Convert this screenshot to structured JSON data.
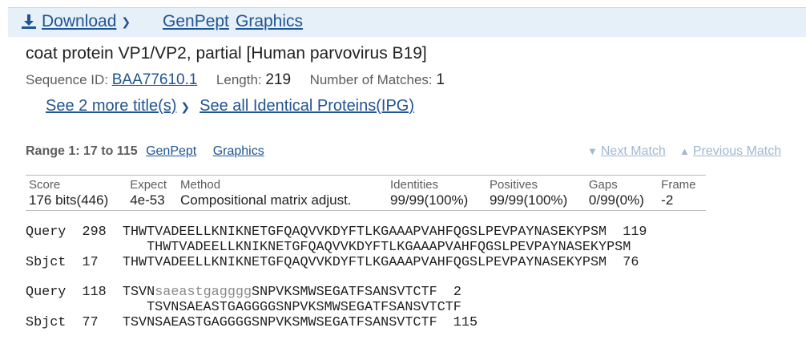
{
  "toolbar": {
    "download_label": "Download",
    "genpept_label": "GenPept",
    "graphics_label": "Graphics"
  },
  "record": {
    "title": "coat protein VP1/VP2, partial [Human parvovirus B19]",
    "seqid_label": "Sequence ID:",
    "seqid_value": "BAA77610.1",
    "length_label": "Length:",
    "length_value": "219",
    "matches_label": "Number of Matches:",
    "matches_value": "1",
    "more_titles_label": "See 2 more title(s)",
    "identical_label": "See all Identical Proteins(IPG)"
  },
  "range": {
    "label": "Range 1: 17 to 115",
    "genpept_label": "GenPept",
    "graphics_label": "Graphics",
    "next_match": "Next Match",
    "previous_match": "Previous Match"
  },
  "stats": {
    "headers": [
      "Score",
      "Expect",
      "Method",
      "Identities",
      "Positives",
      "Gaps",
      "Frame"
    ],
    "values": [
      "176 bits(446)",
      "4e-53",
      "Compositional matrix adjust.",
      "99/99(100%)",
      "99/99(100%)",
      "0/99(0%)",
      "-2"
    ]
  },
  "alignment": [
    {
      "query": {
        "label": "Query",
        "start": "298",
        "seq_upper": "THWTVADEELLKNIKNETGFQAQVVKDYFTLKGAAAPVAHFQGSLPEVPAYNASEKYPSM",
        "end": "119"
      },
      "midline": "THWTVADEELLKNIKNETGFQAQVVKDYFTLKGAAAPVAHFQGSLPEVPAYNASEKYPSM",
      "sbjct": {
        "label": "Sbjct",
        "start": "17",
        "seq": "THWTVADEELLKNIKNETGFQAQVVKDYFTLKGAAAPVAHFQGSLPEVPAYNASEKYPSM",
        "end": "76"
      }
    },
    {
      "query": {
        "label": "Query",
        "start": "118",
        "seq_a": "TSVN",
        "seq_lower": "saeastgagggg",
        "seq_b": "SNPVKSMWSEGATFSANSVTCTF",
        "end": "2"
      },
      "midline": "TSVNSAEASTGAGGGGSNPVKSMWSEGATFSANSVTCTF",
      "sbjct": {
        "label": "Sbjct",
        "start": "77",
        "seq": "TSVNSAEASTGAGGGGSNPVKSMWSEGATFSANSVTCTF",
        "end": "115"
      }
    }
  ]
}
